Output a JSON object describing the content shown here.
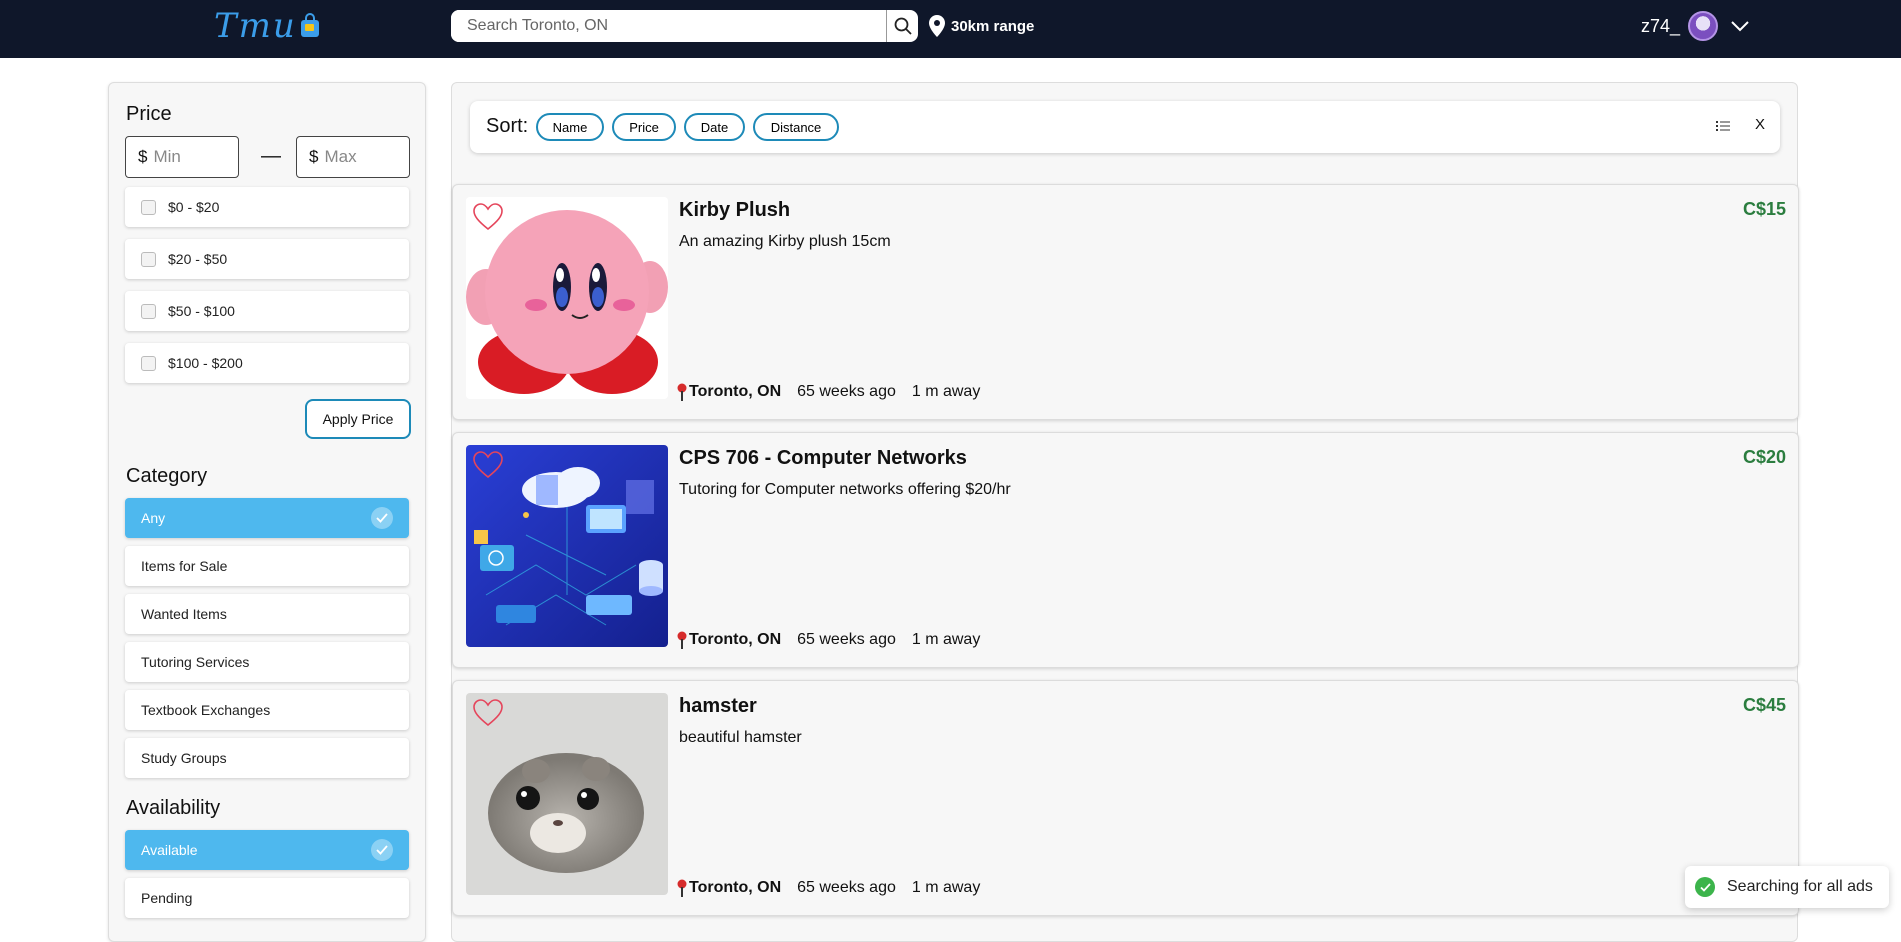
{
  "header": {
    "logo_text": "Tmu",
    "search_placeholder": "Search Toronto, ON",
    "range_label": "30km range",
    "username": "z74_"
  },
  "filters": {
    "price": {
      "title": "Price",
      "min_symbol": "$",
      "max_symbol": "$",
      "min_placeholder": "Min",
      "max_placeholder": "Max",
      "dash": "—",
      "ranges": [
        "$0 - $20",
        "$20 - $50",
        "$50 - $100",
        "$100 - $200"
      ],
      "apply_label": "Apply Price"
    },
    "category": {
      "title": "Category",
      "options": [
        "Any",
        "Items for Sale",
        "Wanted Items",
        "Tutoring Services",
        "Textbook Exchanges",
        "Study Groups"
      ],
      "selected": "Any"
    },
    "availability": {
      "title": "Availability",
      "options": [
        "Available",
        "Pending"
      ],
      "selected": "Available"
    }
  },
  "sort": {
    "label": "Sort:",
    "options": [
      "Name",
      "Price",
      "Date",
      "Distance"
    ],
    "close_label": "X"
  },
  "listings": [
    {
      "title": "Kirby Plush",
      "description": "An amazing Kirby plush 15cm",
      "price": "C$15",
      "location": "Toronto, ON",
      "posted": "65 weeks ago",
      "distance": "1 m away"
    },
    {
      "title": "CPS 706 - Computer Networks",
      "description": "Tutoring for Computer networks offering $20/hr",
      "price": "C$20",
      "location": "Toronto, ON",
      "posted": "65 weeks ago",
      "distance": "1 m away"
    },
    {
      "title": "hamster",
      "description": "beautiful hamster",
      "price": "C$45",
      "location": "Toronto, ON",
      "posted": "65 weeks ago",
      "distance": "1 m away"
    }
  ],
  "toast": {
    "message": "Searching for all ads"
  },
  "colors": {
    "topbar": "#0f172a",
    "accent": "#4eb8ee",
    "price": "#2b7d3f",
    "heart": "#e5455b"
  }
}
